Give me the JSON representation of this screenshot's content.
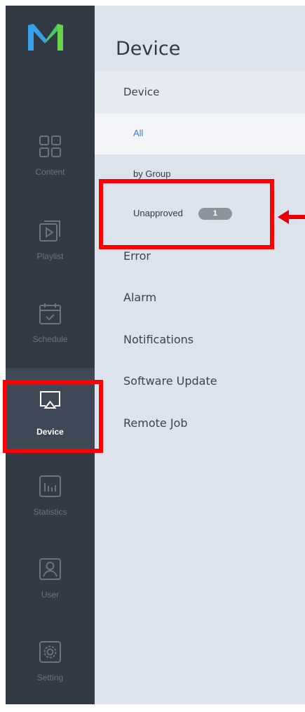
{
  "colors": {
    "rail_bg": "#323a46",
    "rail_active": "#3f4856",
    "panel_bg": "#dde3ec",
    "accent": "#3a7ad8",
    "highlight": "#ff0000"
  },
  "nav": [
    {
      "label": "Content",
      "icon": "grid-icon"
    },
    {
      "label": "Playlist",
      "icon": "playlist-icon"
    },
    {
      "label": "Schedule",
      "icon": "calendar-icon"
    },
    {
      "label": "Device",
      "icon": "screen-cast-icon",
      "active": true
    },
    {
      "label": "Statistics",
      "icon": "bar-chart-icon"
    },
    {
      "label": "User",
      "icon": "user-icon"
    },
    {
      "label": "Setting",
      "icon": "gear-icon"
    }
  ],
  "panel": {
    "title": "Device",
    "section": "Device",
    "sub_items": {
      "all": "All",
      "by_group": "by Group",
      "unapproved": "Unapproved",
      "unapproved_count": "1"
    },
    "menu": [
      "Error",
      "Alarm",
      "Notifications",
      "Software Update",
      "Remote Job"
    ]
  }
}
